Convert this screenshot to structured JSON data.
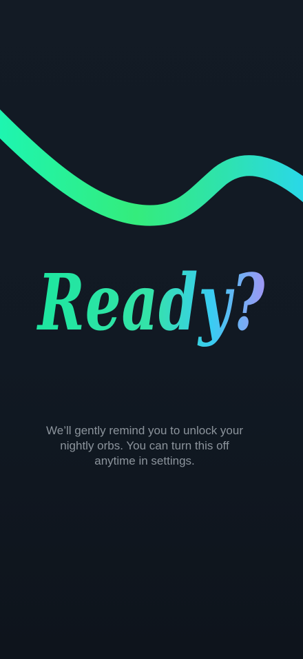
{
  "onboarding": {
    "headline": "Ready?",
    "body": "We’ll gently remind you to unlock your nightly orbs. You can turn this off anytime in settings."
  },
  "colors": {
    "background": "#111923",
    "gradient_start": "#1fe6a0",
    "gradient_mid": "#39ccf2",
    "gradient_end": "#b48cf5",
    "wave_start": "#1ef5b0",
    "wave_mid": "#33e87a",
    "wave_end": "#2ad8e8",
    "body_text": "#8c949c"
  },
  "decorations": {
    "wave": "flowing-wave-stroke"
  }
}
